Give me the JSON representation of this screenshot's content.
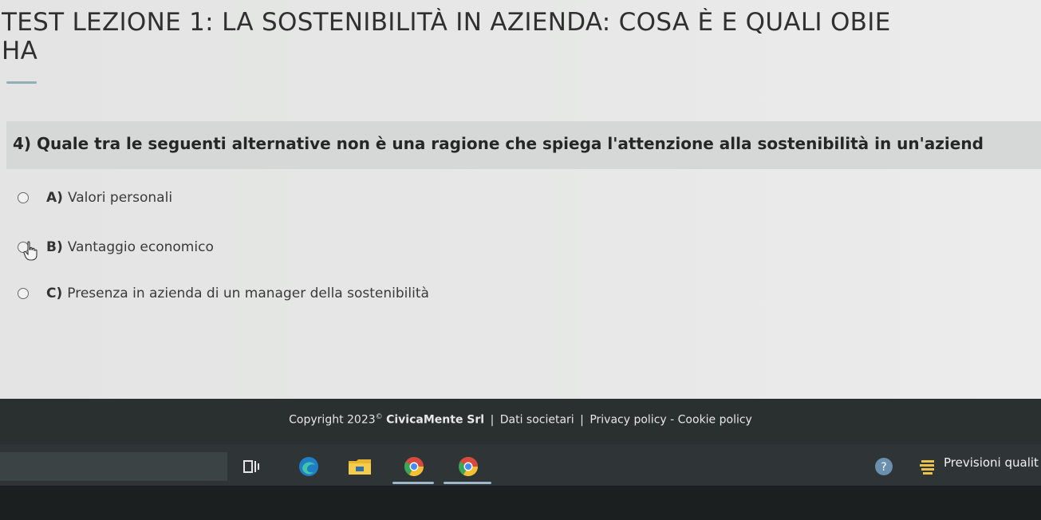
{
  "page": {
    "title_line1": "TEST LEZIONE 1: LA SOSTENIBILITÀ IN AZIENDA: COSA È E QUALI OBIE",
    "title_line2": "HA"
  },
  "question": {
    "text": "4) Quale tra le seguenti alternative non è una ragione che spiega l'attenzione alla sostenibilità in un'aziend"
  },
  "options": [
    {
      "letter": "A)",
      "text": "Valori personali"
    },
    {
      "letter": "B)",
      "text": "Vantaggio economico"
    },
    {
      "letter": "C)",
      "text": "Presenza in azienda di un manager della sostenibilità"
    }
  ],
  "footer": {
    "copyright": "Copyright 2023",
    "symbol": "©",
    "company": "CivicaMente Srl",
    "sep": "|",
    "dati": "Dati societari",
    "privacy": "Privacy policy",
    "dash": "-",
    "cookie": "Cookie policy"
  },
  "taskbar": {
    "tray_label": "Previsioni qualit",
    "icons": [
      "task-view-icon",
      "edge-icon",
      "file-explorer-icon",
      "chrome-icon",
      "chrome-alt-icon"
    ]
  },
  "colors": {
    "footer_bg": "#2a2f30",
    "question_bg": "#d6d8d8",
    "accent": "#8fb0b6"
  }
}
